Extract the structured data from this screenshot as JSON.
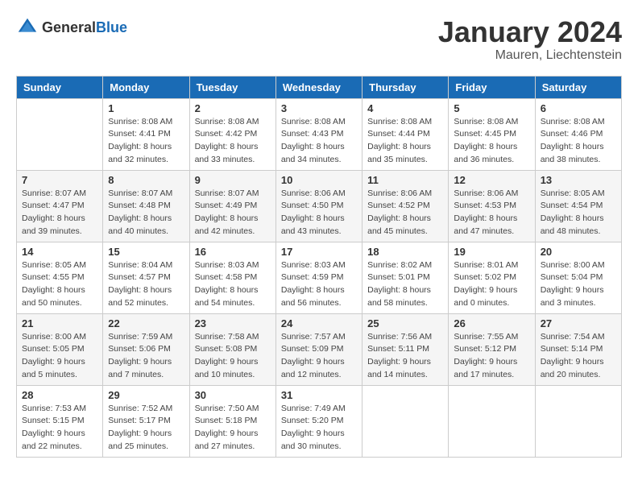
{
  "header": {
    "logo_general": "General",
    "logo_blue": "Blue",
    "month": "January 2024",
    "location": "Mauren, Liechtenstein"
  },
  "weekdays": [
    "Sunday",
    "Monday",
    "Tuesday",
    "Wednesday",
    "Thursday",
    "Friday",
    "Saturday"
  ],
  "weeks": [
    [
      {
        "day": "",
        "info": ""
      },
      {
        "day": "1",
        "info": "Sunrise: 8:08 AM\nSunset: 4:41 PM\nDaylight: 8 hours\nand 32 minutes."
      },
      {
        "day": "2",
        "info": "Sunrise: 8:08 AM\nSunset: 4:42 PM\nDaylight: 8 hours\nand 33 minutes."
      },
      {
        "day": "3",
        "info": "Sunrise: 8:08 AM\nSunset: 4:43 PM\nDaylight: 8 hours\nand 34 minutes."
      },
      {
        "day": "4",
        "info": "Sunrise: 8:08 AM\nSunset: 4:44 PM\nDaylight: 8 hours\nand 35 minutes."
      },
      {
        "day": "5",
        "info": "Sunrise: 8:08 AM\nSunset: 4:45 PM\nDaylight: 8 hours\nand 36 minutes."
      },
      {
        "day": "6",
        "info": "Sunrise: 8:08 AM\nSunset: 4:46 PM\nDaylight: 8 hours\nand 38 minutes."
      }
    ],
    [
      {
        "day": "7",
        "info": "Sunrise: 8:07 AM\nSunset: 4:47 PM\nDaylight: 8 hours\nand 39 minutes."
      },
      {
        "day": "8",
        "info": "Sunrise: 8:07 AM\nSunset: 4:48 PM\nDaylight: 8 hours\nand 40 minutes."
      },
      {
        "day": "9",
        "info": "Sunrise: 8:07 AM\nSunset: 4:49 PM\nDaylight: 8 hours\nand 42 minutes."
      },
      {
        "day": "10",
        "info": "Sunrise: 8:06 AM\nSunset: 4:50 PM\nDaylight: 8 hours\nand 43 minutes."
      },
      {
        "day": "11",
        "info": "Sunrise: 8:06 AM\nSunset: 4:52 PM\nDaylight: 8 hours\nand 45 minutes."
      },
      {
        "day": "12",
        "info": "Sunrise: 8:06 AM\nSunset: 4:53 PM\nDaylight: 8 hours\nand 47 minutes."
      },
      {
        "day": "13",
        "info": "Sunrise: 8:05 AM\nSunset: 4:54 PM\nDaylight: 8 hours\nand 48 minutes."
      }
    ],
    [
      {
        "day": "14",
        "info": "Sunrise: 8:05 AM\nSunset: 4:55 PM\nDaylight: 8 hours\nand 50 minutes."
      },
      {
        "day": "15",
        "info": "Sunrise: 8:04 AM\nSunset: 4:57 PM\nDaylight: 8 hours\nand 52 minutes."
      },
      {
        "day": "16",
        "info": "Sunrise: 8:03 AM\nSunset: 4:58 PM\nDaylight: 8 hours\nand 54 minutes."
      },
      {
        "day": "17",
        "info": "Sunrise: 8:03 AM\nSunset: 4:59 PM\nDaylight: 8 hours\nand 56 minutes."
      },
      {
        "day": "18",
        "info": "Sunrise: 8:02 AM\nSunset: 5:01 PM\nDaylight: 8 hours\nand 58 minutes."
      },
      {
        "day": "19",
        "info": "Sunrise: 8:01 AM\nSunset: 5:02 PM\nDaylight: 9 hours\nand 0 minutes."
      },
      {
        "day": "20",
        "info": "Sunrise: 8:00 AM\nSunset: 5:04 PM\nDaylight: 9 hours\nand 3 minutes."
      }
    ],
    [
      {
        "day": "21",
        "info": "Sunrise: 8:00 AM\nSunset: 5:05 PM\nDaylight: 9 hours\nand 5 minutes."
      },
      {
        "day": "22",
        "info": "Sunrise: 7:59 AM\nSunset: 5:06 PM\nDaylight: 9 hours\nand 7 minutes."
      },
      {
        "day": "23",
        "info": "Sunrise: 7:58 AM\nSunset: 5:08 PM\nDaylight: 9 hours\nand 10 minutes."
      },
      {
        "day": "24",
        "info": "Sunrise: 7:57 AM\nSunset: 5:09 PM\nDaylight: 9 hours\nand 12 minutes."
      },
      {
        "day": "25",
        "info": "Sunrise: 7:56 AM\nSunset: 5:11 PM\nDaylight: 9 hours\nand 14 minutes."
      },
      {
        "day": "26",
        "info": "Sunrise: 7:55 AM\nSunset: 5:12 PM\nDaylight: 9 hours\nand 17 minutes."
      },
      {
        "day": "27",
        "info": "Sunrise: 7:54 AM\nSunset: 5:14 PM\nDaylight: 9 hours\nand 20 minutes."
      }
    ],
    [
      {
        "day": "28",
        "info": "Sunrise: 7:53 AM\nSunset: 5:15 PM\nDaylight: 9 hours\nand 22 minutes."
      },
      {
        "day": "29",
        "info": "Sunrise: 7:52 AM\nSunset: 5:17 PM\nDaylight: 9 hours\nand 25 minutes."
      },
      {
        "day": "30",
        "info": "Sunrise: 7:50 AM\nSunset: 5:18 PM\nDaylight: 9 hours\nand 27 minutes."
      },
      {
        "day": "31",
        "info": "Sunrise: 7:49 AM\nSunset: 5:20 PM\nDaylight: 9 hours\nand 30 minutes."
      },
      {
        "day": "",
        "info": ""
      },
      {
        "day": "",
        "info": ""
      },
      {
        "day": "",
        "info": ""
      }
    ]
  ]
}
